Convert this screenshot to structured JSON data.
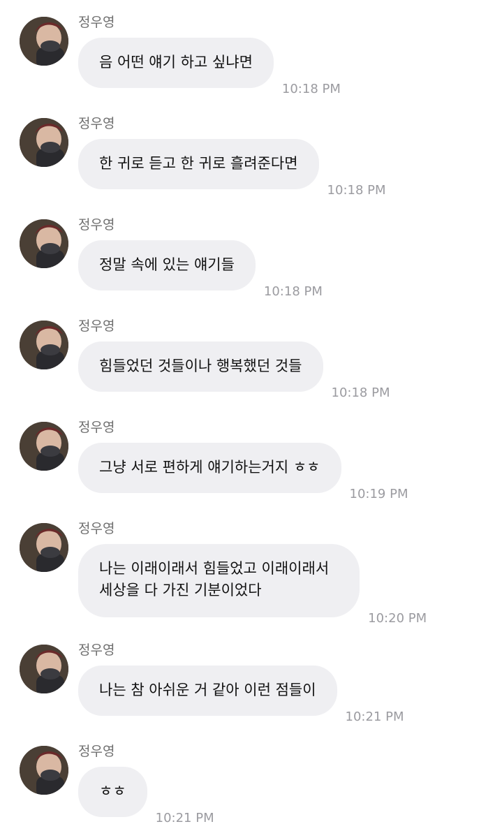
{
  "sender": "정우영",
  "messages": [
    {
      "text": "음 어떤 얘기 하고 싶냐면",
      "time": "10:18 PM"
    },
    {
      "text": "한 귀로 듣고 한 귀로 흘려준다면",
      "time": "10:18 PM"
    },
    {
      "text": "정말 속에 있는 얘기들",
      "time": "10:18 PM"
    },
    {
      "text": "힘들었던 것들이나 행복했던 것들",
      "time": "10:18 PM"
    },
    {
      "text": "그냥 서로 편하게 얘기하는거지 ㅎㅎ",
      "time": "10:19 PM"
    },
    {
      "line1": "나는 이래이래서 힘들었고 이래이래서",
      "line2": "세상을 다 가진 기분이었다",
      "time": "10:20 PM"
    },
    {
      "text": "나는 참 아쉬운 거 같아 이런 점들이",
      "time": "10:21 PM"
    },
    {
      "text": "ㅎㅎ",
      "time": "10:21 PM"
    }
  ]
}
